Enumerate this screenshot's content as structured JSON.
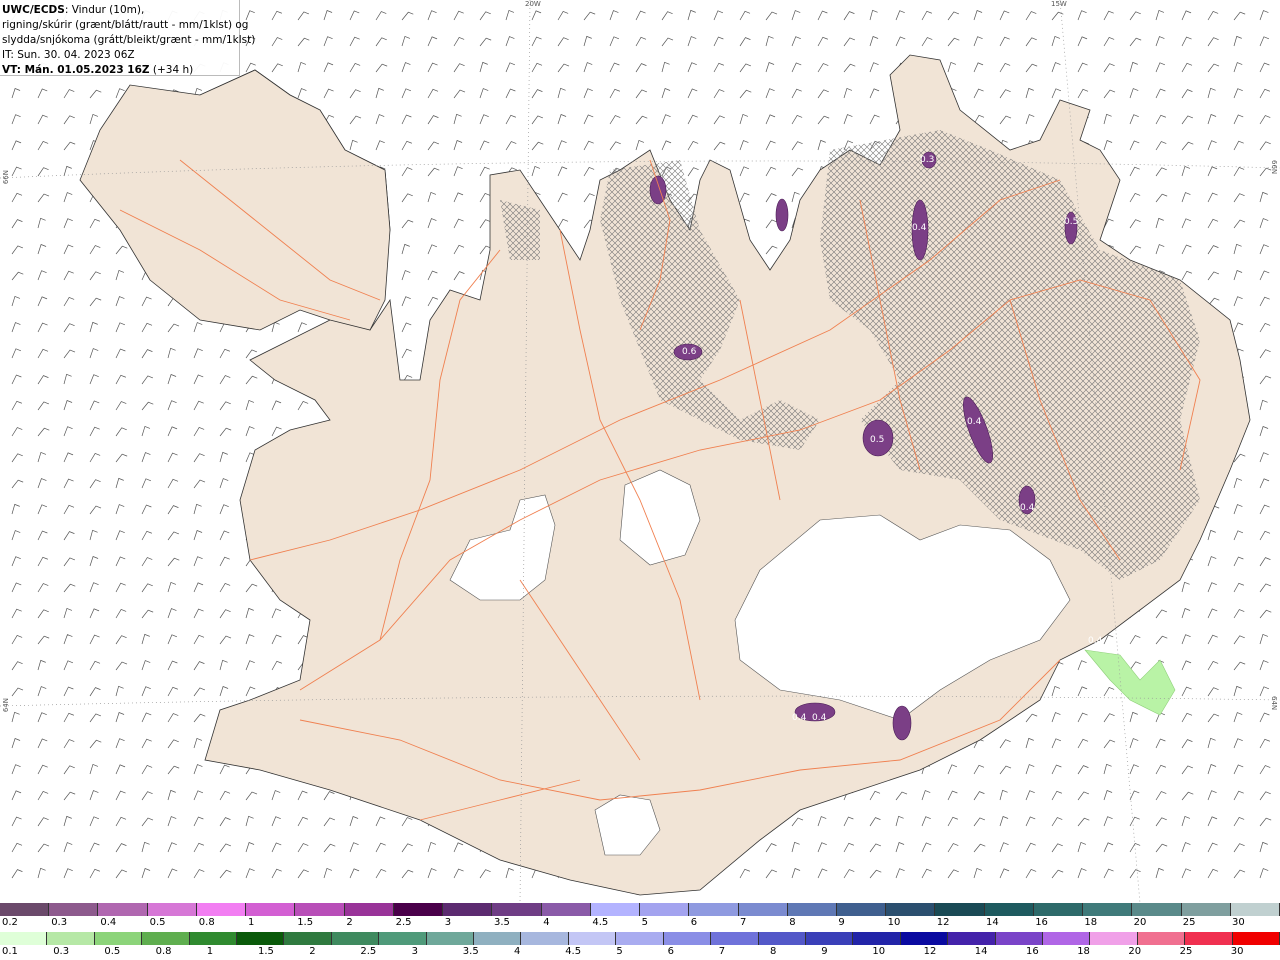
{
  "header": {
    "title_bold": "UWC/ECDS",
    "title_rest": ": Vindur (10m),",
    "line2": "rigning/skúrir (grænt/blátt/rautt - mm/1klst) og",
    "line3": "slydda/snjókoma (grátt/bleikt/grænt - mm/1klst)",
    "line4": "IT: Sun. 30. 04. 2023 06Z",
    "vt_bold": "VT: Mán. 01.05.2023 16Z",
    "vt_rest": " (+34 h)"
  },
  "grid_labels": {
    "top": [
      "20W",
      "15W"
    ],
    "left": [
      "66N",
      "64N"
    ],
    "right": [
      "66N",
      "64N"
    ]
  },
  "map_labels": [
    "0.5",
    "0.4",
    "0.4",
    "0.4",
    "0.5",
    "0.4",
    "0.4",
    "0.4",
    "0.6",
    "0.3"
  ],
  "colors": {
    "land": "#f1e4d6",
    "glacier": "#ffffff",
    "roads": "#f08050",
    "sleet": "#7b3f86",
    "rain": "#b9f3a6"
  },
  "legend": {
    "snow_ticks": [
      "0.2",
      "0.3",
      "0.4",
      "0.5",
      "0.8",
      "1",
      "1.5",
      "2",
      "2.5",
      "3",
      "3.5",
      "4",
      "4.5",
      "5",
      "6",
      "7",
      "8",
      "9",
      "10",
      "12",
      "14",
      "16",
      "18",
      "20",
      "25",
      "30"
    ],
    "snow_colors": [
      "#6b4a6b",
      "#8d5a8d",
      "#b067b0",
      "#d677d6",
      "#f27ef2",
      "#d35fd3",
      "#b84eb8",
      "#993399",
      "#4a004a",
      "#5c2a70",
      "#6f3d85",
      "#8a5aa8",
      "#b3b3ff",
      "#a3a3ef",
      "#8f9ae0",
      "#7b8bd0",
      "#5f78b5",
      "#3f5f8f",
      "#2b4f6f",
      "#1a4a55",
      "#1e5a5f",
      "#2d6a6a",
      "#3f7a7a",
      "#5a8a8a",
      "#7f9f9f",
      "#c0d0d0"
    ],
    "rain_ticks": [
      "0.1",
      "0.3",
      "0.5",
      "0.8",
      "1",
      "1.5",
      "2",
      "2.5",
      "3",
      "3.5",
      "4",
      "4.5",
      "5",
      "6",
      "7",
      "8",
      "9",
      "10",
      "12",
      "14",
      "16",
      "18",
      "20",
      "25",
      "30"
    ],
    "rain_colors": [
      "#dfffd8",
      "#b6e8a6",
      "#8cd47a",
      "#5fae4f",
      "#2f8a2f",
      "#0a5a0a",
      "#2f7a3f",
      "#3f8a5f",
      "#4f9a7a",
      "#6fa89a",
      "#8fb0c0",
      "#a7b7de",
      "#c3c6f5",
      "#a9acf0",
      "#8a8ee6",
      "#6f72da",
      "#5358c8",
      "#3a3fb8",
      "#2224a8",
      "#0a0aa0",
      "#4422aa",
      "#7a44c8",
      "#b066e6",
      "#f0a0e8",
      "#f07090",
      "#f03050",
      "#f00000"
    ]
  }
}
